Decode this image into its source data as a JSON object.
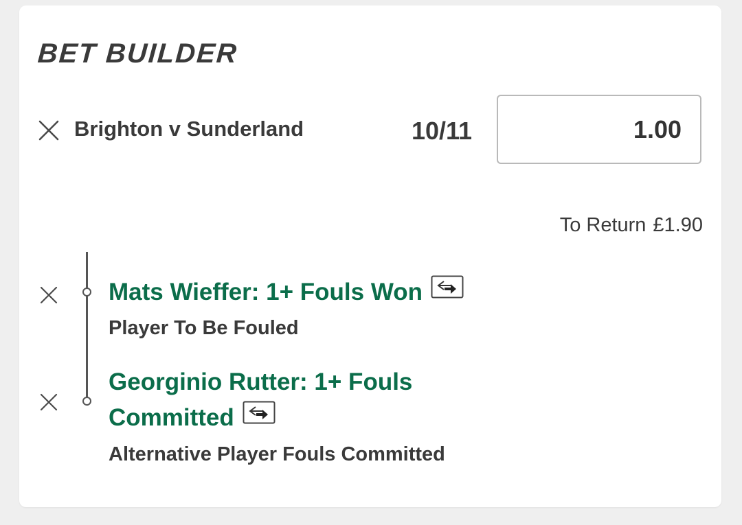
{
  "bet_builder": {
    "title": "BET BUILDER",
    "event": {
      "name": "Brighton v Sunderland",
      "odds": "10/11",
      "stake_value": "1.00"
    },
    "to_return": {
      "label": "To Return",
      "amount": "£1.90"
    },
    "selections": [
      {
        "name_line1": "Mats Wieffer: 1+ Fouls Won",
        "name_line2": "",
        "market": "Player To Be Fouled"
      },
      {
        "name_line1": "Georginio Rutter: 1+ Fouls",
        "name_line2": "Committed",
        "market": "Alternative Player Fouls Committed"
      }
    ]
  },
  "icons": {
    "remove": "close-icon",
    "swap": "swap-arrows-icon"
  },
  "colors": {
    "selection_green": "#0b6d4a",
    "text_dark": "#3a3a3a",
    "background": "#efefef",
    "card": "#ffffff"
  }
}
